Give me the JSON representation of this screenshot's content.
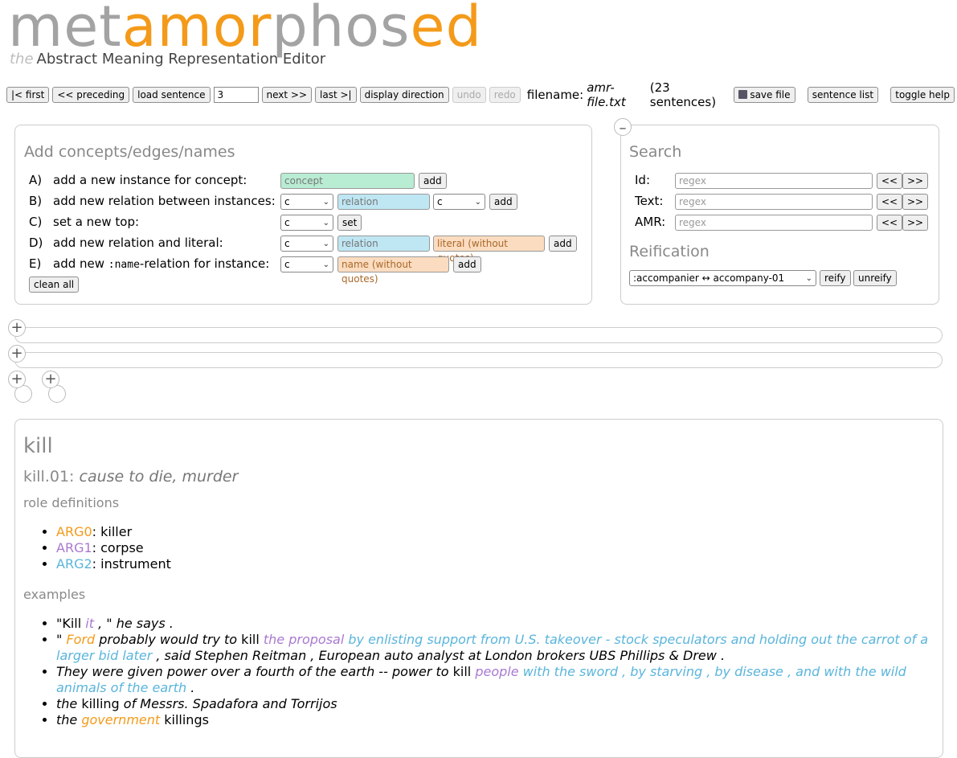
{
  "logo": {
    "part1": "met",
    "part2": "amor",
    "part3": "phos",
    "part4": "ed"
  },
  "subtitle": {
    "the": "the",
    "text": "Abstract Meaning Representation Editor"
  },
  "toolbar": {
    "first": "|< first",
    "preceding": "<< preceding",
    "load": "load sentence",
    "sentence_value": "3",
    "next": "next >>",
    "last": "last >|",
    "display_direction": "display direction",
    "undo": "undo",
    "redo": "redo",
    "filename_label": "filename:",
    "filename": "amr-file.txt",
    "count": "(23 sentences)",
    "save": "save file",
    "sentence_list": "sentence list",
    "toggle_help": "toggle help"
  },
  "add_panel": {
    "title": "Add concepts/edges/names",
    "rows": [
      {
        "key": "A)",
        "label": "add a new instance for concept:"
      },
      {
        "key": "B)",
        "label": "add new relation between instances:"
      },
      {
        "key": "C)",
        "label": "set a new top:"
      },
      {
        "key": "D)",
        "label": "add new relation and literal:"
      },
      {
        "key": "E)",
        "label_pre": "add new ",
        "label_code": ":name",
        "label_post": "-relation for instance:"
      }
    ],
    "concept_placeholder": "concept",
    "relation_placeholder": "relation",
    "literal_placeholder": "literal (without quotes)",
    "name_placeholder": "name (without quotes)",
    "select_value": "c",
    "add": "add",
    "set": "set",
    "clean_all": "clean all"
  },
  "search_panel": {
    "collapse": "–",
    "title": "Search",
    "rows": [
      {
        "label": "Id:"
      },
      {
        "label": "Text:"
      },
      {
        "label": "AMR:"
      }
    ],
    "placeholder": "regex",
    "prev": "<<",
    "next": ">>",
    "reification_title": "Reification",
    "reification_value": ":accompanier ↔ accompany-01",
    "reify": "reify",
    "unreify": "unreify"
  },
  "expanders": {
    "plus": "+"
  },
  "frame": {
    "title": "kill",
    "sense_id": "kill.01:",
    "sense_gloss": "cause to die, murder",
    "role_header": "role definitions",
    "roles": [
      {
        "arg": "ARG0",
        "desc": ": killer"
      },
      {
        "arg": "ARG1",
        "desc": ": corpse"
      },
      {
        "arg": "ARG2",
        "desc": ": instrument"
      }
    ],
    "examples_header": "examples",
    "ex1": {
      "a": "\"",
      "b": "Kill",
      "c": "it",
      "d": " , \" he says ."
    },
    "ex2": {
      "a": "\" ",
      "b": "Ford",
      "c": " probably would try to ",
      "d": "kill",
      "e": "the proposal",
      "f": " by enlisting support from U.S. takeover - stock speculators and holding out the carrot of a larger bid later",
      "g": " , said Stephen Reitman , European auto analyst at London brokers UBS Phillips & Drew ."
    },
    "ex3": {
      "a": "They were given power over a fourth of the earth -- power to ",
      "b": "kill",
      "c": "people",
      "d": " with the sword , by starving , by disease , and with the wild animals of the earth",
      "e": " ."
    },
    "ex4": {
      "a": "the ",
      "b": "killing",
      "c": " of Messrs. Spadafora and Torrijos"
    },
    "ex5": {
      "a": "the ",
      "b": "government",
      "c": " killings"
    }
  },
  "colors": {
    "accent_orange": "#f49a1a",
    "logo_grey": "#a3a3a3",
    "arg1_purple": "#a979d1",
    "arg2_blue": "#5ab5dc"
  }
}
